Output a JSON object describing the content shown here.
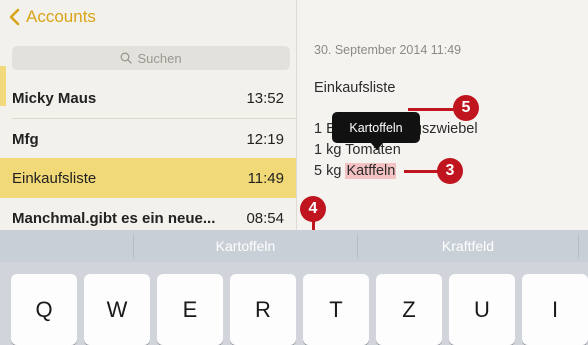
{
  "nav": {
    "back_label": "Accounts"
  },
  "search": {
    "placeholder": "Suchen"
  },
  "notes": [
    {
      "title": "Micky Maus",
      "time": "13:52"
    },
    {
      "title": "Mfg",
      "time": "12:19"
    },
    {
      "title": "Einkaufsliste",
      "time": "11:49"
    },
    {
      "title": "Manchmal.gibt es ein neue...",
      "time": "08:54"
    }
  ],
  "note": {
    "date": "30. September 2014 11:49",
    "title": "Einkaufsliste",
    "line1_a": "1 Bu",
    "line1_b": "ngszwiebel",
    "line2_a": "1 kg To",
    "line2_b": "maten",
    "line3_prefix": "5 kg ",
    "line3_word": "Katffeln"
  },
  "popup": {
    "label": "Kartoffeln"
  },
  "callouts": {
    "badge_5": "5",
    "badge_3": "3",
    "badge_4": "4"
  },
  "suggestions": [
    "Kartoffeln",
    "Kraftfeld"
  ],
  "keys": [
    "Q",
    "W",
    "E",
    "R",
    "T",
    "Z",
    "U",
    "I"
  ],
  "colors": {
    "accent": "#d8a419",
    "selected_row": "#f2d978",
    "highlight": "#f4c2c2",
    "callout": "#c0141e"
  }
}
